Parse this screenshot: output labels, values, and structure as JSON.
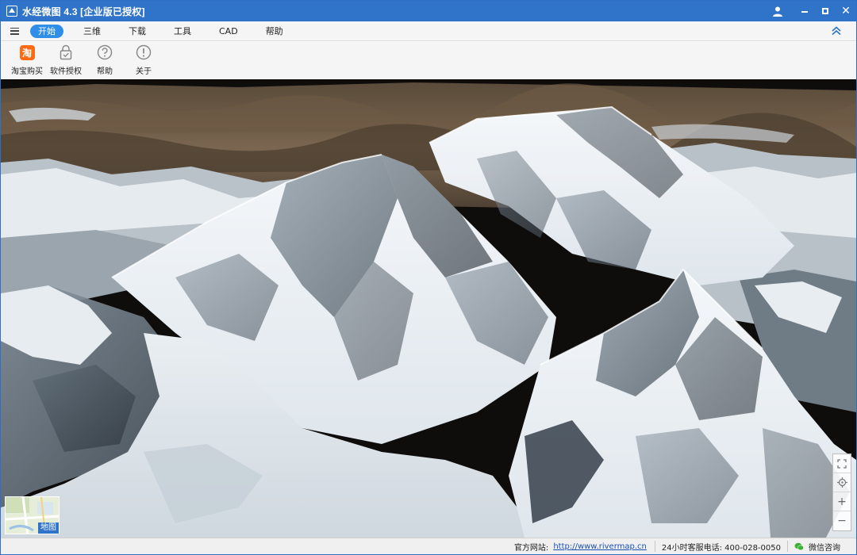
{
  "window": {
    "title": "水经微图 4.3 [企业版已授权]"
  },
  "title_controls": [
    "user-icon",
    "minimize-icon",
    "maximize-icon",
    "close-icon"
  ],
  "menu": {
    "tabs": [
      {
        "label": "开始",
        "active": true
      },
      {
        "label": "三维",
        "active": false
      },
      {
        "label": "下载",
        "active": false
      },
      {
        "label": "工具",
        "active": false
      },
      {
        "label": "CAD",
        "active": false
      },
      {
        "label": "帮助",
        "active": false
      }
    ]
  },
  "ribbon": {
    "buttons": [
      {
        "label": "淘宝购买",
        "icon": "taobao-icon",
        "glyph": "淘"
      },
      {
        "label": "软件授权",
        "icon": "lock-icon"
      },
      {
        "label": "帮助",
        "icon": "help-icon"
      },
      {
        "label": "关于",
        "icon": "info-icon"
      }
    ]
  },
  "map": {
    "minimap_label": "地图",
    "tools": [
      "fullscreen-icon",
      "locate-icon",
      "zoom-in-icon",
      "zoom-out-icon"
    ]
  },
  "status": {
    "site_label": "官方网站:",
    "site_url": "http://www.rivermap.cn",
    "phone": "24小时客服电话: 400-028-0050",
    "wechat": "微信咨询"
  },
  "colors": {
    "titlebar": "#2f74c8",
    "active_tab": "#2f8ee8",
    "taobao": "#ff6a13"
  }
}
